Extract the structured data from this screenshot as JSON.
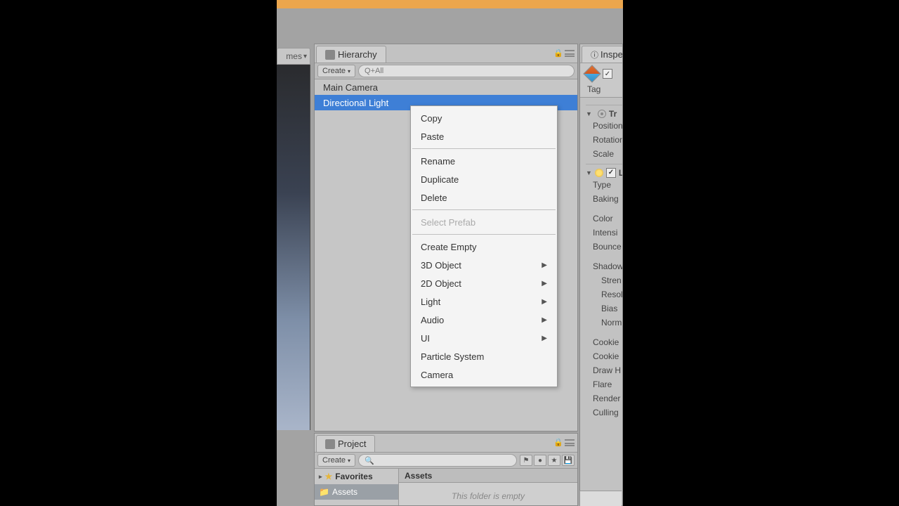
{
  "left_tab": {
    "label": "mes"
  },
  "hierarchy": {
    "tab": "Hierarchy",
    "create": "Create",
    "search_placeholder": "Q+All",
    "items": [
      {
        "label": "Main Camera",
        "selected": false
      },
      {
        "label": "Directional Light",
        "selected": true
      }
    ]
  },
  "context_menu": {
    "items": [
      {
        "label": "Copy",
        "type": "item"
      },
      {
        "label": "Paste",
        "type": "item"
      },
      {
        "type": "sep"
      },
      {
        "label": "Rename",
        "type": "item"
      },
      {
        "label": "Duplicate",
        "type": "item"
      },
      {
        "label": "Delete",
        "type": "item"
      },
      {
        "type": "sep"
      },
      {
        "label": "Select Prefab",
        "type": "item",
        "disabled": true
      },
      {
        "type": "sep"
      },
      {
        "label": "Create Empty",
        "type": "item"
      },
      {
        "label": "3D Object",
        "type": "submenu"
      },
      {
        "label": "2D Object",
        "type": "submenu"
      },
      {
        "label": "Light",
        "type": "submenu"
      },
      {
        "label": "Audio",
        "type": "submenu"
      },
      {
        "label": "UI",
        "type": "submenu"
      },
      {
        "label": "Particle System",
        "type": "item"
      },
      {
        "label": "Camera",
        "type": "item"
      }
    ]
  },
  "project": {
    "tab": "Project",
    "create": "Create",
    "search_placeholder": "",
    "tree": {
      "favorites": "Favorites",
      "assets": "Assets"
    },
    "content_header": "Assets",
    "empty": "This folder is empty"
  },
  "inspector": {
    "tab": "Inspec",
    "tag_label": "Tag",
    "components": {
      "transform": {
        "title": "Tr",
        "position": "Position",
        "rotation": "Rotation",
        "scale": "Scale"
      },
      "light": {
        "title": "Li",
        "type": "Type",
        "baking": "Baking",
        "color": "Color",
        "intensity": "Intensi",
        "bounce": "Bounce",
        "shadow": "Shadow",
        "strength": "Stren",
        "resolution": "Resol",
        "bias": "Bias",
        "normal": "Norm",
        "cookie": "Cookie",
        "cookie_size": "Cookie",
        "draw_halo": "Draw H",
        "flare": "Flare",
        "render": "Render",
        "culling": "Culling"
      }
    }
  }
}
